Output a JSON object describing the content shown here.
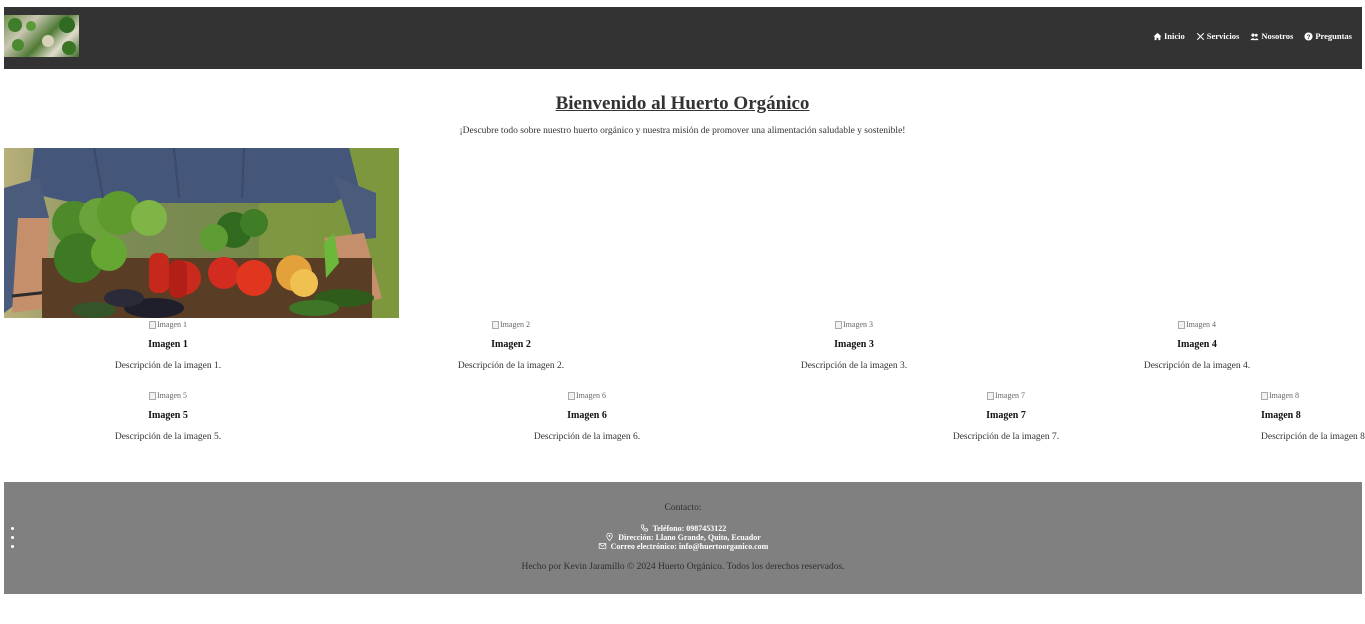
{
  "header": {
    "logo_alt": "Huerto Orgánico logo",
    "nav": [
      {
        "label": "Inicio",
        "icon": "home-icon"
      },
      {
        "label": "Servicios",
        "icon": "tools-icon"
      },
      {
        "label": "Nosotros",
        "icon": "users-icon"
      },
      {
        "label": "Preguntas",
        "icon": "question-icon"
      }
    ]
  },
  "hero": {
    "title": "Bienvenido al Huerto Orgánico",
    "subtitle": "¡Descubre todo sobre nuestro huerto orgánico y nuestra misión de promover una alimentación saludable y sostenible!"
  },
  "gallery": [
    {
      "alt": "Imagen 1",
      "title": "Imagen 1",
      "desc": "Descripción de la imagen 1."
    },
    {
      "alt": "Imagen 2",
      "title": "Imagen 2",
      "desc": "Descripción de la imagen 2."
    },
    {
      "alt": "Imagen 3",
      "title": "Imagen 3",
      "desc": "Descripción de la imagen 3."
    },
    {
      "alt": "Imagen 4",
      "title": "Imagen 4",
      "desc": "Descripción de la imagen 4."
    },
    {
      "alt": "Imagen 5",
      "title": "Imagen 5",
      "desc": "Descripción de la imagen 5."
    },
    {
      "alt": "Imagen 6",
      "title": "Imagen 6",
      "desc": "Descripción de la imagen 6."
    },
    {
      "alt": "Imagen 7",
      "title": "Imagen 7",
      "desc": "Descripción de la imagen 7."
    },
    {
      "alt": "Imagen 8",
      "title": "Imagen 8",
      "desc": "Descripción de la imagen 8."
    }
  ],
  "footer": {
    "contact_title": "Contacto:",
    "phone": "Teléfono: 0987453122",
    "address": "Dirección: Llano Grande, Quito, Ecuador",
    "email": "Correo electrónico: info@huertoorganico.com",
    "copyright": "Hecho por Kevin Jaramillo © 2024 Huerto Orgánico. Todos los derechos reservados."
  },
  "colors": {
    "header_bg": "#333333",
    "footer_bg": "#808080",
    "text": "#333333"
  }
}
